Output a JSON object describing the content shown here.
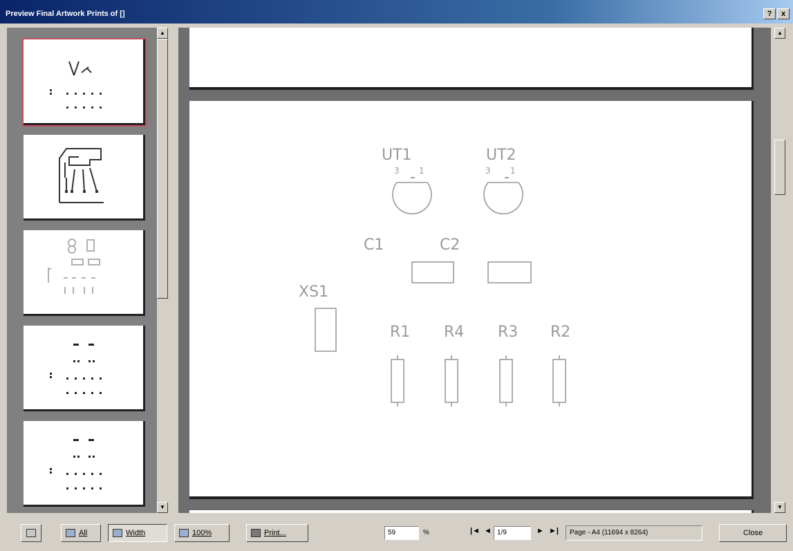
{
  "window": {
    "title": "Preview Final Artwork Prints of []",
    "help_btn": "?",
    "close_btn": "x"
  },
  "thumbnails": [
    {
      "label": "Page 1 thumbnail",
      "selected": true
    },
    {
      "label": "Page 2 thumbnail",
      "selected": false
    },
    {
      "label": "Page 3 thumbnail",
      "selected": false
    },
    {
      "label": "Page 4 thumbnail",
      "selected": false
    },
    {
      "label": "Page 5 thumbnail",
      "selected": false
    }
  ],
  "preview": {
    "components": {
      "ut1": "UT1",
      "ut2": "UT2",
      "c1": "C1",
      "c2": "C2",
      "xs1": "XS1",
      "r1": "R1",
      "r4": "R4",
      "r3": "R3",
      "r2": "R2"
    },
    "pin_marks": {
      "left": "3",
      "right": "1"
    }
  },
  "toolbar": {
    "all_label": "All",
    "width_label": "Width",
    "zoom100_label": "100%",
    "print_label": "Print...",
    "zoom_value": "59",
    "zoom_unit": "%",
    "first_glyph": "|◄",
    "prev_glyph": "◄",
    "page_value": "1/9",
    "next_glyph": "►",
    "last_glyph": "►|",
    "status": "Page - A4 (11694 x 8264)",
    "close_label": "Close"
  },
  "colors": {
    "silk": "#9a9a9a",
    "selection": "#c0505e"
  },
  "icons": [
    "help-icon",
    "close-icon",
    "scroll-up-icon",
    "scroll-down-icon",
    "all-pages-icon",
    "fit-width-icon",
    "zoom-100-icon",
    "printer-icon"
  ]
}
